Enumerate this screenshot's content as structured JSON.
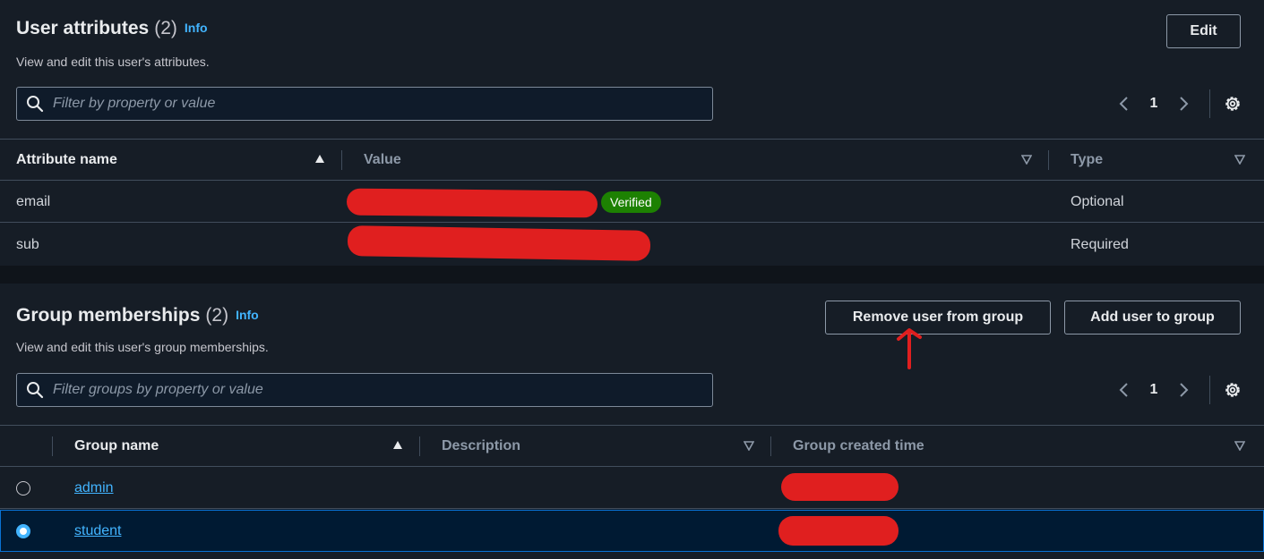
{
  "user_attributes": {
    "title": "User attributes",
    "count": "(2)",
    "info": "Info",
    "description": "View and edit this user's attributes.",
    "edit_label": "Edit",
    "filter_placeholder": "Filter by property or value",
    "page": "1",
    "columns": [
      "Attribute name",
      "Value",
      "Type"
    ],
    "rows": [
      {
        "name": "email",
        "badge": "Verified",
        "type": "Optional"
      },
      {
        "name": "sub",
        "type": "Required"
      }
    ]
  },
  "group_memberships": {
    "title": "Group memberships",
    "count": "(2)",
    "info": "Info",
    "description": "View and edit this user's group memberships.",
    "remove_label": "Remove user from group",
    "add_label": "Add user to group",
    "filter_placeholder": "Filter groups by property or value",
    "page": "1",
    "columns": [
      "Group name",
      "Description",
      "Group created time"
    ],
    "rows": [
      {
        "name": "admin",
        "selected": false
      },
      {
        "name": "student",
        "selected": true
      }
    ]
  },
  "colors": {
    "accent": "#42b4ff",
    "verified": "#1d8102",
    "redaction": "#e01f1f",
    "selected_row": "#001a33"
  }
}
